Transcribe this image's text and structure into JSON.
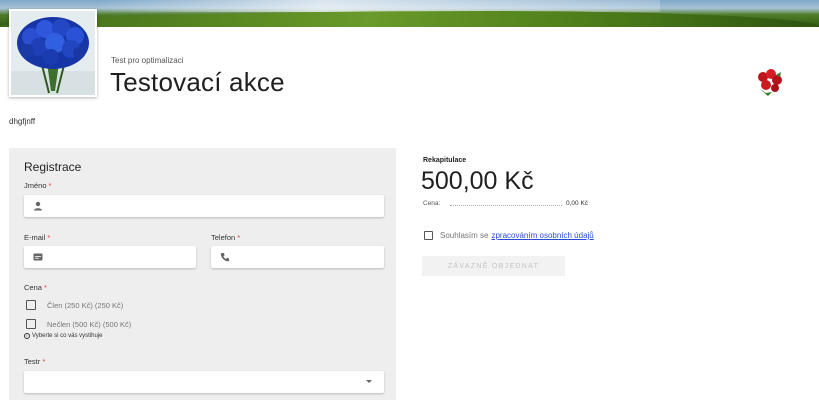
{
  "event": {
    "subtitle": "Test pro optimalizaci",
    "title": "Testovací akce",
    "description": "dhgfjnff"
  },
  "form": {
    "title": "Registrace",
    "name_label": "Jméno",
    "email_label": "E-mail",
    "phone_label": "Telefon",
    "price_label": "Cena",
    "price_options": [
      "Člen (250 Kč) (250 Kč)",
      "Nečlen (500 Kč) (500 Kč)"
    ],
    "price_hint": "Vyberte si co vás vystihuje",
    "select_label": "Testr",
    "required_mark": "*"
  },
  "summary": {
    "title": "Rekapitulace",
    "total": "500,00 Kč",
    "price_label": "Cena:",
    "price_value": "0,00 Kč",
    "consent_text": "Souhlasím se",
    "consent_link": "zpracováním osobních údajů",
    "order_button": "ZÁVAZNĚ OBJEDNAT"
  },
  "icons": {
    "name_field": "person-icon",
    "email_field": "email-icon",
    "phone_field": "phone-icon",
    "select_field": "chevron-down-icon",
    "hint": "info-icon"
  },
  "colors": {
    "required": "#e53935",
    "link": "#2a4bd8",
    "form_background": "#eeeeee"
  }
}
